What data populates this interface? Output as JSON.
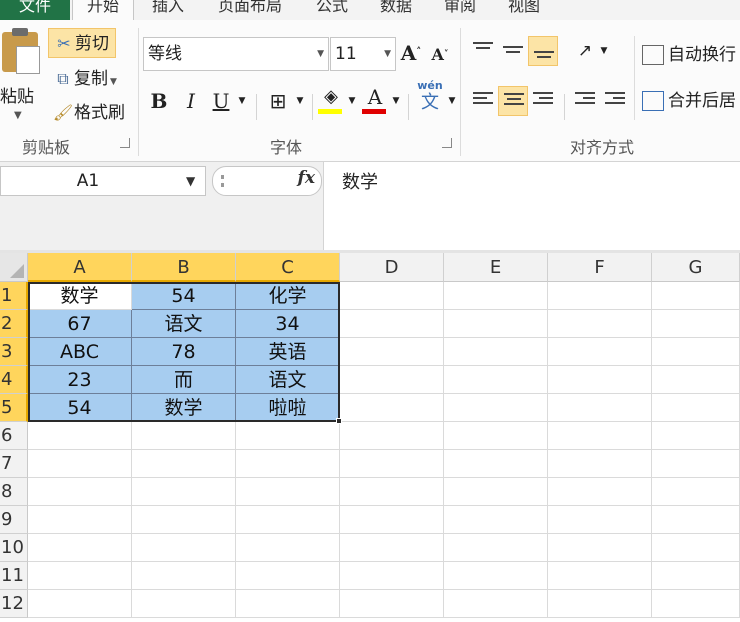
{
  "tabs": {
    "file": "文件",
    "items": [
      "开始",
      "插入",
      "页面布局",
      "公式",
      "数据",
      "审阅",
      "视图"
    ]
  },
  "clipboard": {
    "paste": "粘贴",
    "cut": "剪切",
    "copy": "复制",
    "format_painter": "格式刷",
    "group_label": "剪贴板"
  },
  "font": {
    "name": "等线",
    "size": "11",
    "bold": "B",
    "italic": "I",
    "underline": "U",
    "font_color_letter": "A",
    "phonetic": "wén",
    "group_label": "字体",
    "fill_color": "#ffff00",
    "text_color": "#e00000"
  },
  "alignment": {
    "wrap_text": "自动换行",
    "merge_center": "合并后居",
    "group_label": "对齐方式"
  },
  "formula_bar": {
    "name_box": "A1",
    "fx": "fx",
    "content": "数学"
  },
  "grid": {
    "columns": [
      "A",
      "B",
      "C",
      "D",
      "E",
      "F",
      "G"
    ],
    "rows": [
      "1",
      "2",
      "3",
      "4",
      "5",
      "6",
      "7",
      "8",
      "9",
      "10",
      "11",
      "12"
    ],
    "cells": [
      [
        "数学",
        "54",
        "化学"
      ],
      [
        "67",
        "语文",
        "34"
      ],
      [
        "ABC",
        "78",
        "英语"
      ],
      [
        "23",
        "而",
        "语文"
      ],
      [
        "54",
        "数学",
        "啦啦"
      ]
    ]
  },
  "colors": {
    "selection": "#a7cdf0",
    "header_highlight": "#ffd55c",
    "active_button": "#fce4a6",
    "file_tab": "#217346"
  }
}
